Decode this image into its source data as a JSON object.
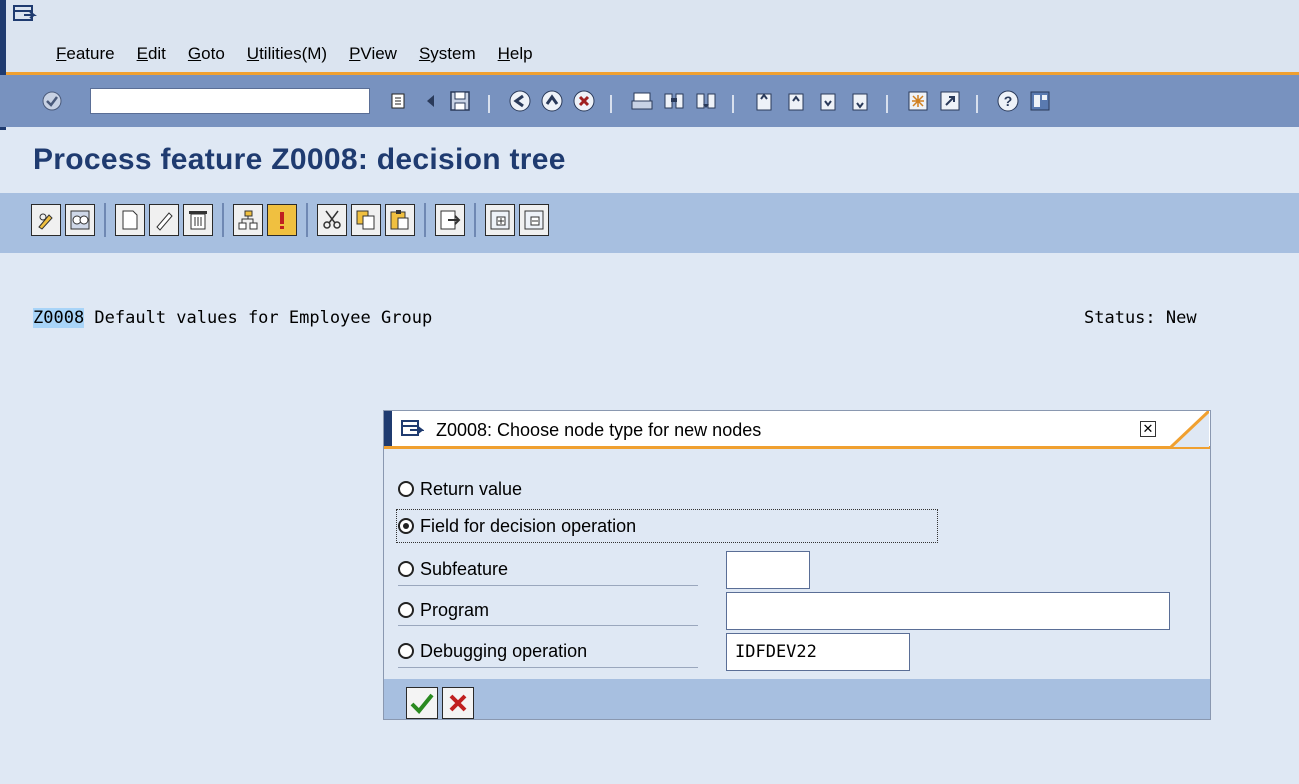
{
  "menubar": {
    "items": [
      "Feature",
      "Edit",
      "Goto",
      "Utilities(M)",
      "PView",
      "System",
      "Help"
    ]
  },
  "toolbar": {
    "command_value": ""
  },
  "page": {
    "title": "Process feature Z0008: decision tree",
    "feature_code": "Z0008",
    "feature_desc": " Default values for Employee Group",
    "status": "Status: New"
  },
  "dialog": {
    "title": "Z0008: Choose node type for new nodes",
    "options": [
      {
        "label": "Return value",
        "selected": false
      },
      {
        "label": "Field for decision operation",
        "selected": true
      },
      {
        "label": "Subfeature",
        "selected": false
      },
      {
        "label": "Program",
        "selected": false
      },
      {
        "label": "Debugging operation",
        "selected": false
      }
    ],
    "subfeature_value": "",
    "program_value": "",
    "debugging_value": "IDFDEV22"
  },
  "colors": {
    "accent": "#f0a030",
    "navy": "#1f3b70",
    "toolbar_dark": "#7892bf",
    "toolbar_light": "#a7bfe0"
  }
}
